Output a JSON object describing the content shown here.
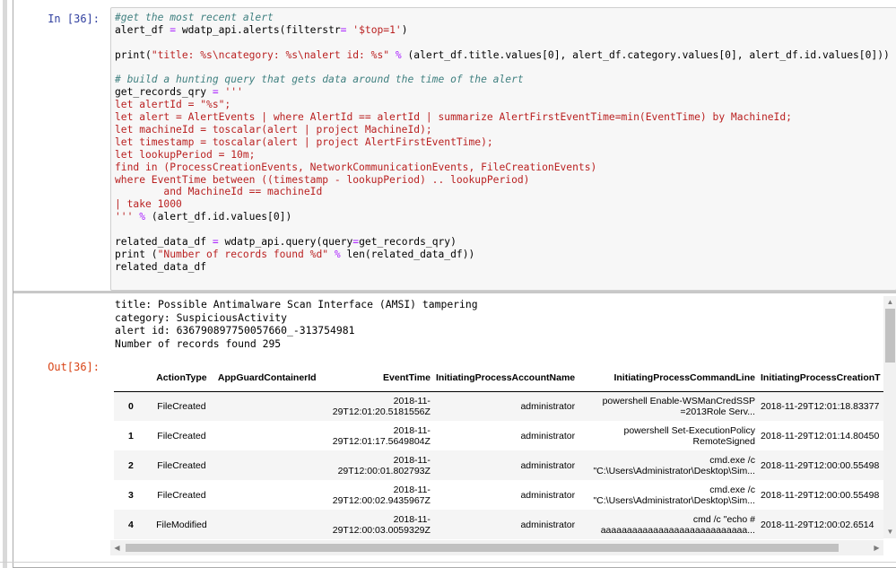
{
  "input_prompt": "In [36]:",
  "output_prompt": "Out[36]:",
  "code_lines": [
    [
      {
        "t": "#get the most recent alert",
        "c": "cm"
      }
    ],
    [
      {
        "t": "alert_df "
      },
      {
        "t": "=",
        "c": "op"
      },
      {
        "t": " wdatp_api.alerts(filterstr"
      },
      {
        "t": "=",
        "c": "op"
      },
      {
        "t": " "
      },
      {
        "t": "'$top=1'",
        "c": "st"
      },
      {
        "t": ")"
      }
    ],
    [
      {
        "t": ""
      }
    ],
    [
      {
        "t": "print(",
        "c": ""
      },
      {
        "t": "\"title: %s\\ncategory: %s\\nalert id: %s\"",
        "c": "st"
      },
      {
        "t": " "
      },
      {
        "t": "%",
        "c": "op"
      },
      {
        "t": " (alert_df.title.values[0], alert_df.category.values[0], alert_df.id.values[0]))"
      }
    ],
    [
      {
        "t": ""
      }
    ],
    [
      {
        "t": "# build a hunting query that gets data around the time of the alert",
        "c": "cm"
      }
    ],
    [
      {
        "t": "get_records_qry "
      },
      {
        "t": "=",
        "c": "op"
      },
      {
        "t": " "
      },
      {
        "t": "'''",
        "c": "st"
      }
    ],
    [
      {
        "t": "let alertId = \"%s\";",
        "c": "st"
      }
    ],
    [
      {
        "t": "let alert = AlertEvents | where AlertId == alertId | summarize AlertFirstEventTime=min(EventTime) by MachineId;",
        "c": "st"
      }
    ],
    [
      {
        "t": "let machineId = toscalar(alert | project MachineId);",
        "c": "st"
      }
    ],
    [
      {
        "t": "let timestamp = toscalar(alert | project AlertFirstEventTime);",
        "c": "st"
      }
    ],
    [
      {
        "t": "let lookupPeriod = 10m;",
        "c": "st"
      }
    ],
    [
      {
        "t": "find in (ProcessCreationEvents, NetworkCommunicationEvents, FileCreationEvents)",
        "c": "st"
      }
    ],
    [
      {
        "t": "where EventTime between ((timestamp - lookupPeriod) .. lookupPeriod)",
        "c": "st"
      }
    ],
    [
      {
        "t": "        and MachineId == machineId",
        "c": "st"
      }
    ],
    [
      {
        "t": "| take 1000",
        "c": "st"
      }
    ],
    [
      {
        "t": "'''",
        "c": "st"
      },
      {
        "t": " "
      },
      {
        "t": "%",
        "c": "op"
      },
      {
        "t": " (alert_df.id.values[0])"
      }
    ],
    [
      {
        "t": ""
      }
    ],
    [
      {
        "t": "related_data_df "
      },
      {
        "t": "=",
        "c": "op"
      },
      {
        "t": " wdatp_api.query(query"
      },
      {
        "t": "=",
        "c": "op"
      },
      {
        "t": "get_records_qry)"
      }
    ],
    [
      {
        "t": "print ("
      },
      {
        "t": "\"Number of records found %d\"",
        "c": "st"
      },
      {
        "t": " "
      },
      {
        "t": "%",
        "c": "op"
      },
      {
        "t": " len(related_data_df))"
      }
    ],
    [
      {
        "t": "related_data_df"
      }
    ]
  ],
  "stream_output": [
    "title: Possible Antimalware Scan Interface (AMSI) tampering",
    "category: SuspiciousActivity",
    "alert id: 636790897750057660_-313754981",
    "Number of records found 295"
  ],
  "table": {
    "columns": [
      "",
      "ActionType",
      "AppGuardContainerId",
      "EventTime",
      "InitiatingProcessAccountName",
      "InitiatingProcessCommandLine",
      "InitiatingProcessCreationT"
    ],
    "rows": [
      {
        "idx": "0",
        "action": "FileCreated",
        "app": "",
        "time": [
          "2018-11-",
          "29T12:01:20.5181556Z"
        ],
        "acct": "administrator",
        "cmd": [
          "powershell Enable-WSManCredSSP",
          "=2013Role Serv..."
        ],
        "create": "2018-11-29T12:01:18.83377"
      },
      {
        "idx": "1",
        "action": "FileCreated",
        "app": "",
        "time": [
          "2018-11-",
          "29T12:01:17.5649804Z"
        ],
        "acct": "administrator",
        "cmd": [
          "powershell Set-ExecutionPolicy",
          "RemoteSigned"
        ],
        "create": "2018-11-29T12:01:14.80450"
      },
      {
        "idx": "2",
        "action": "FileCreated",
        "app": "",
        "time": [
          "2018-11-",
          "29T12:00:01.802793Z"
        ],
        "acct": "administrator",
        "cmd": [
          "cmd.exe /c",
          "\"C:\\Users\\Administrator\\Desktop\\Sim..."
        ],
        "create": "2018-11-29T12:00:00.55498"
      },
      {
        "idx": "3",
        "action": "FileCreated",
        "app": "",
        "time": [
          "2018-11-",
          "29T12:00:02.9435967Z"
        ],
        "acct": "administrator",
        "cmd": [
          "cmd.exe /c",
          "\"C:\\Users\\Administrator\\Desktop\\Sim..."
        ],
        "create": "2018-11-29T12:00:00.55498"
      },
      {
        "idx": "4",
        "action": "FileModified",
        "app": "",
        "time": [
          "2018-11-",
          "29T12:00:03.0059329Z"
        ],
        "acct": "administrator",
        "cmd": [
          "cmd /c \"echo #",
          "aaaaaaaaaaaaaaaaaaaaaaaaaaaa..."
        ],
        "create": "2018-11-29T12:00:02.6514"
      }
    ]
  },
  "icons": {
    "scroll_up": "▲",
    "scroll_down": "▼",
    "scroll_left": "◀",
    "scroll_right": "▶"
  }
}
